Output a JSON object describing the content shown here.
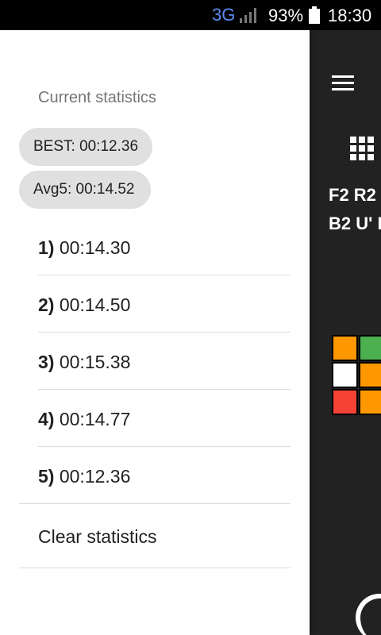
{
  "status_bar": {
    "network": "3G",
    "battery_percent": "93%",
    "time": "18:30"
  },
  "drawer": {
    "section_title": "Current statistics",
    "best_chip": "BEST: 00:12.36",
    "avg_chip": "Avg5: 00:14.52",
    "times": [
      {
        "index": "1)",
        "value": "00:14.30"
      },
      {
        "index": "2)",
        "value": "00:14.50"
      },
      {
        "index": "3)",
        "value": "00:15.38"
      },
      {
        "index": "4)",
        "value": "00:14.77"
      },
      {
        "index": "5)",
        "value": "00:12.36"
      }
    ],
    "clear_label": "Clear statistics"
  },
  "main": {
    "scramble_line1": "F2 R2",
    "scramble_line2": "B2 U' I",
    "cube_colors": [
      "#ff9800",
      "#4caf50",
      "#ffffff",
      "#ff9800",
      "#f44336",
      "#ff9800"
    ]
  }
}
